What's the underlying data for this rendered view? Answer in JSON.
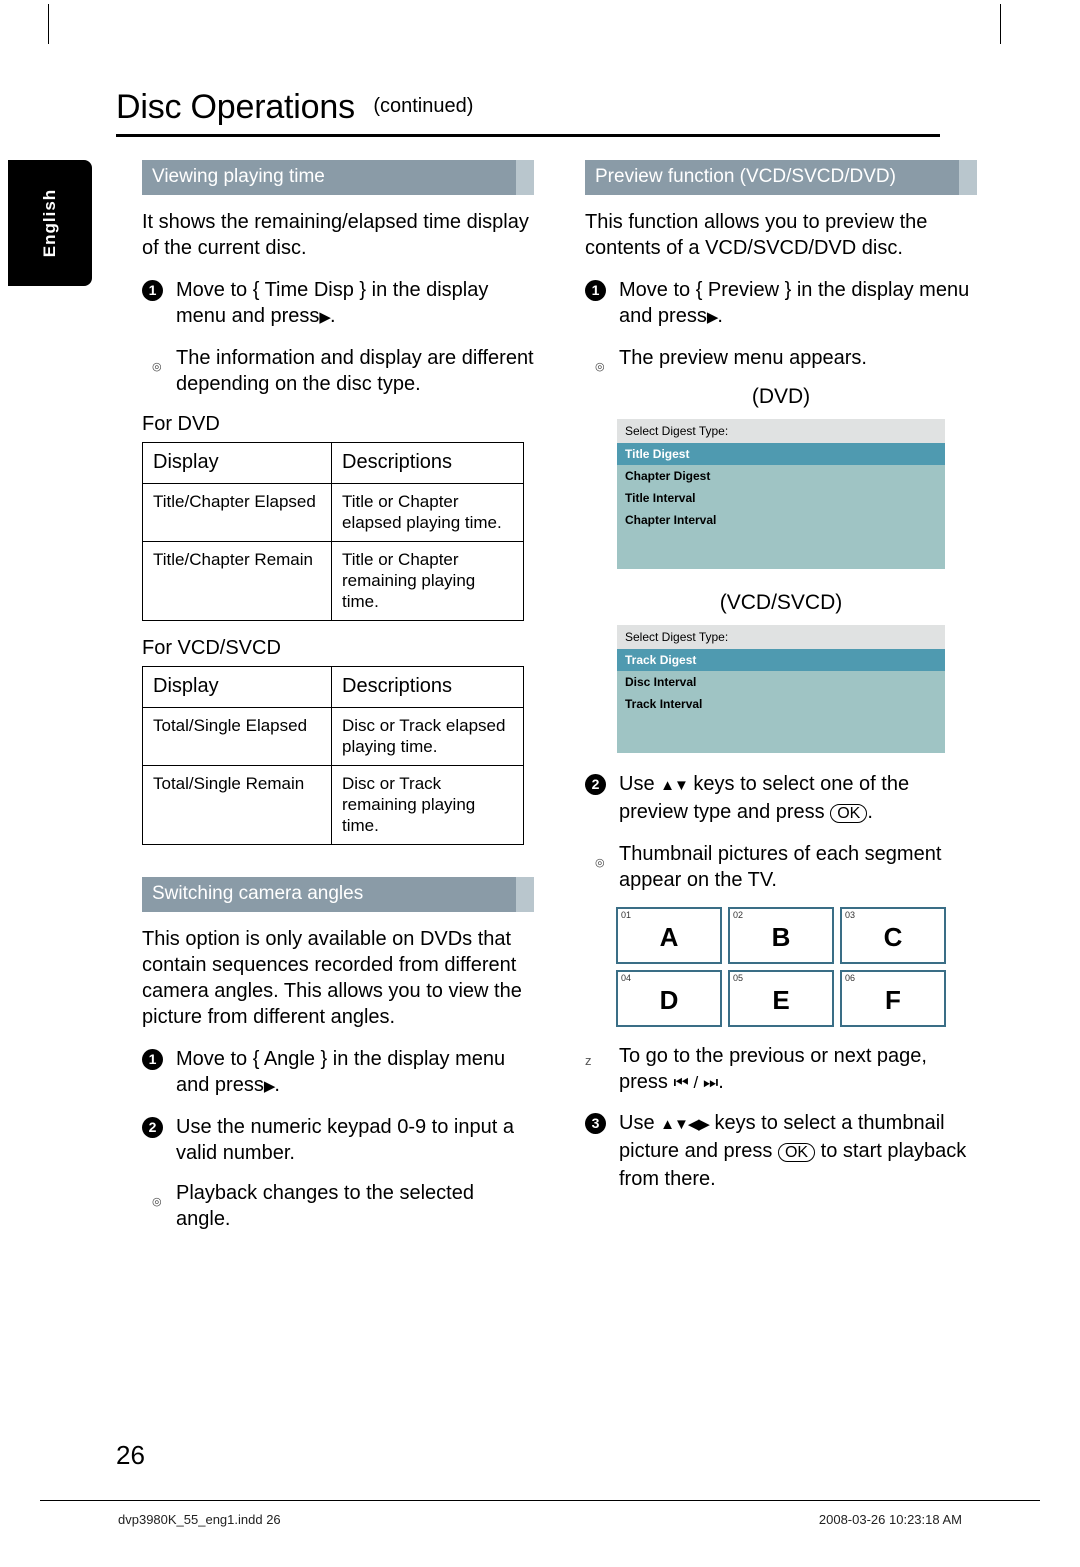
{
  "language_tab": "English",
  "title": {
    "main": "Disc Operations",
    "continued": "(continued)"
  },
  "left_column": {
    "section1": {
      "heading": "Viewing playing time",
      "intro": "It shows the remaining/elapsed time display of the current disc.",
      "step1": "Move to { Time Disp } in the display menu and press",
      "step1_arrow": "▶",
      "step1_end": ".",
      "tip1": "The information and display are different depending on the disc type.",
      "sub_dvd": "For DVD",
      "table_dvd": {
        "headers": [
          "Display",
          "Descriptions"
        ],
        "rows": [
          [
            "Title/Chapter Elapsed",
            "Title or Chapter elapsed playing time."
          ],
          [
            "Title/Chapter Remain",
            "Title or Chapter remaining playing time."
          ]
        ]
      },
      "sub_vcd": "For VCD/SVCD",
      "table_vcd": {
        "headers": [
          "Display",
          "Descriptions"
        ],
        "rows": [
          [
            "Total/Single Elapsed",
            "Disc or Track elapsed playing time."
          ],
          [
            "Total/Single Remain",
            "Disc or Track remaining playing time."
          ]
        ]
      }
    },
    "section2": {
      "heading": "Switching camera angles",
      "intro": "This option is only available on DVDs that contain sequences recorded from different camera angles. This allows you to view the picture from different angles.",
      "step1": "Move to { Angle } in the display menu and press",
      "step1_arrow": "▶",
      "step1_end": ".",
      "step2": "Use the numeric keypad 0-9 to input a valid number.",
      "tip1": "Playback changes to the selected angle."
    }
  },
  "right_column": {
    "heading": "Preview function (VCD/SVCD/DVD)",
    "intro": "This function allows you to preview the contents of a VCD/SVCD/DVD disc.",
    "step1": "Move to { Preview } in the display menu and press",
    "step1_arrow": "▶",
    "step1_end": ".",
    "tip1": "The preview menu appears.",
    "dvd_label": "(DVD)",
    "osd_dvd": {
      "title": "Select Digest Type:",
      "items": [
        "Title  Digest",
        "Chapter  Digest",
        "Title Interval",
        "Chapter Interval"
      ],
      "selected_index": 0
    },
    "vcd_label": "(VCD/SVCD)",
    "osd_vcd": {
      "title": "Select Digest Type:",
      "items": [
        "Track  Digest",
        "Disc Interval",
        "Track Interval"
      ],
      "selected_index": 0
    },
    "step2_a": "Use",
    "step2_keys": "▲▼",
    "step2_b": "keys to select one of the preview type and press",
    "step2_ok": "OK",
    "step2_end": ".",
    "tip2": "Thumbnail pictures of each segment appear on the TV.",
    "thumbnails": [
      {
        "index": "01",
        "letter": "A"
      },
      {
        "index": "02",
        "letter": "B"
      },
      {
        "index": "03",
        "letter": "C"
      },
      {
        "index": "04",
        "letter": "D"
      },
      {
        "index": "05",
        "letter": "E"
      },
      {
        "index": "06",
        "letter": "F"
      }
    ],
    "note_z": "To go to the previous or next page, press",
    "note_keys": "⏮ / ⏭",
    "note_end": ".",
    "step3_a": "Use",
    "step3_keys": "▲▼◀▶",
    "step3_b": "keys to select a thumbnail picture and press",
    "step3_ok": "OK",
    "step3_c": "to start playback from there."
  },
  "footer": {
    "page_number": "26",
    "file_info": "dvp3980K_55_eng1.indd   26",
    "timestamp": "2008-03-26   10:23:18 AM"
  },
  "colors": {
    "section_head": "#8a9ba7",
    "osd_select": "#4f9ab0",
    "osd_body": "#9fc4c4"
  }
}
